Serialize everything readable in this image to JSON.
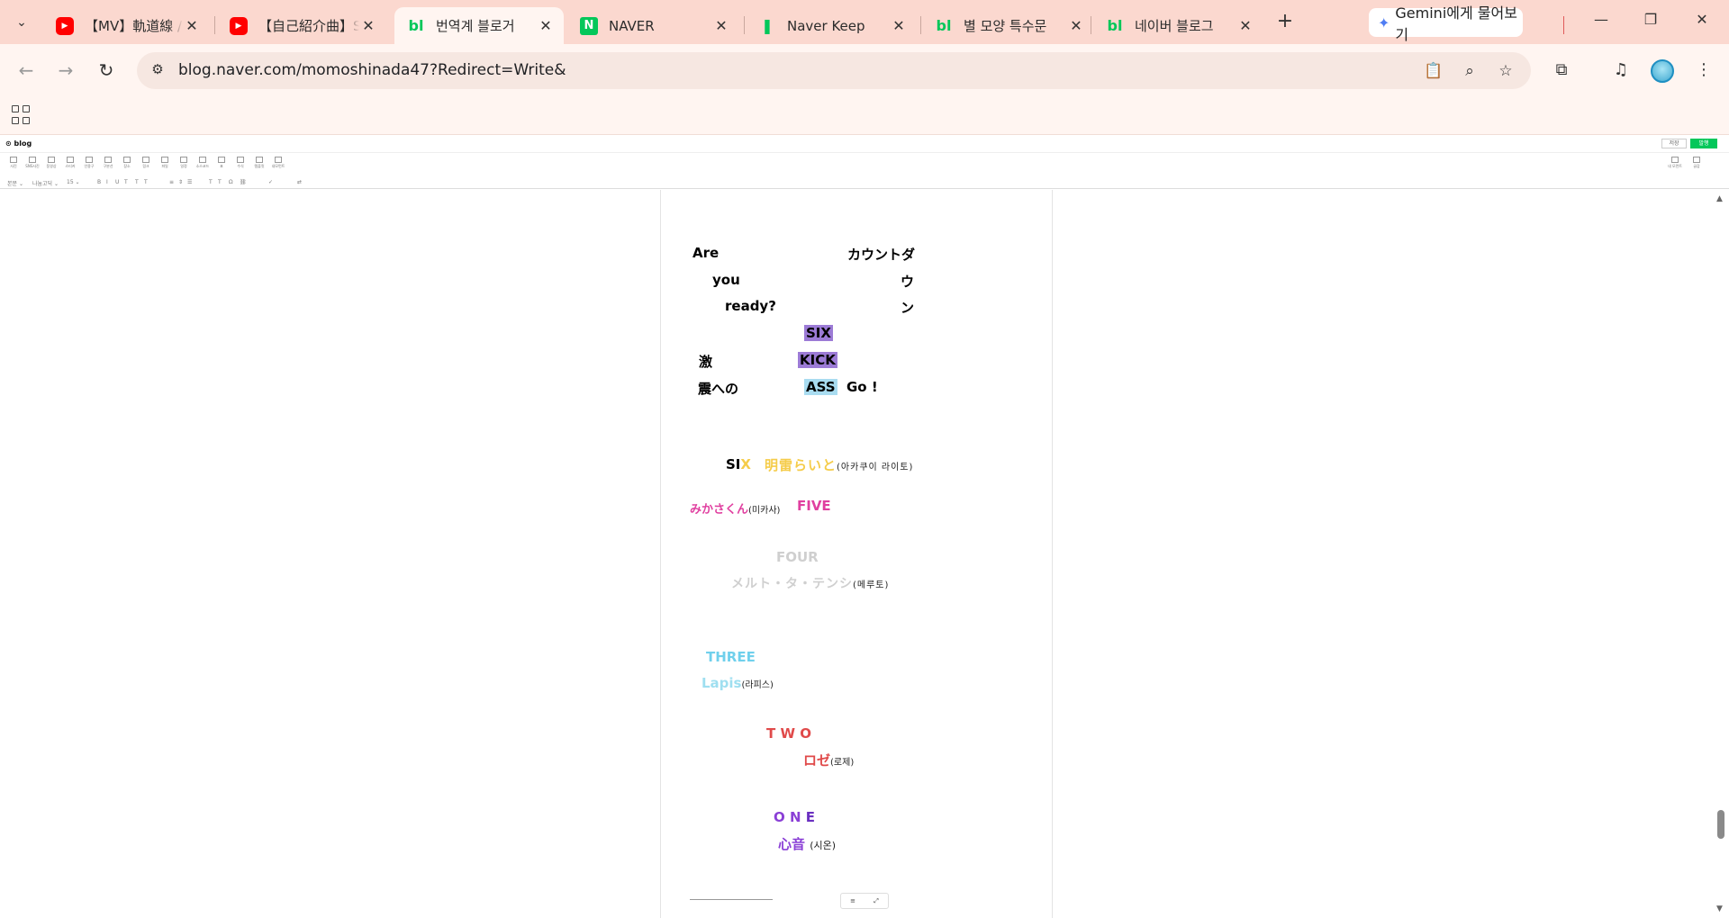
{
  "browser": {
    "tabs": [
      {
        "title": "【MV】軌道線 / E",
        "favicon": "youtube-icon"
      },
      {
        "title": "【自己紹介曲】SI",
        "favicon": "youtube-icon"
      },
      {
        "title": "번역계 블로거 ",
        "favicon": "naver-blog-icon",
        "active": true
      },
      {
        "title": "NAVER",
        "favicon": "naver-icon"
      },
      {
        "title": "Naver Keep",
        "favicon": "naver-keep-icon"
      },
      {
        "title": "별 모양 특수문",
        "favicon": "naver-blog-icon"
      },
      {
        "title": "네이버 블로그",
        "favicon": "naver-blog-icon"
      }
    ],
    "gemini_label": "Gemini에게 물어보기",
    "url": "blog.naver.com/momoshinada47?Redirect=Write&"
  },
  "editor": {
    "logo": "blog",
    "save_label": "저장",
    "publish_label": "발행",
    "tools": [
      "사진",
      "SNS사진",
      "동영상",
      "스티커",
      "인용구",
      "구분선",
      "장소",
      "링크",
      "파일",
      "일정",
      "소스코드",
      "표",
      "수식",
      "템플릿",
      "내모먼트",
      "글감"
    ],
    "right_tools": [
      "내 모먼트",
      "글감"
    ],
    "format": {
      "font_style": "본문",
      "font_family": "나눔고딕",
      "font_size": "15"
    }
  },
  "content": {
    "intro": {
      "are": "Are",
      "you": "you",
      "ready": "ready?",
      "countdown_1": "カウントダ",
      "countdown_2": "ウ",
      "countdown_3": "ン",
      "six": "SIX",
      "kick": "KICK",
      "ass": "ASS",
      "go": "Go !",
      "geki": "激",
      "shin": "震への"
    },
    "six_line": {
      "label_black": "SI",
      "label_yellow": "X",
      "name": "明雷らいと",
      "reading": "(아카쿠이 라이토)"
    },
    "five_line": {
      "name": "みかさくん",
      "reading": "(미카사)",
      "label": "FIVE"
    },
    "four_line": {
      "label": "FOUR",
      "name": "メルト・タ・テンシ",
      "reading": "(메루토)"
    },
    "three_line": {
      "label": "THREE",
      "name": "Lapis",
      "reading": "(라피스)"
    },
    "two_line": {
      "label": "T W O",
      "name": "ロゼ",
      "reading": "(로제)"
    },
    "one_line": {
      "label_a": "O N ",
      "label_b": "E",
      "name": "心音 ",
      "reading": "(시온)"
    }
  },
  "colors": {
    "yellow": "#f5cc4a",
    "pink": "#e040a0",
    "gray": "#cfcfcf",
    "sky": "#70d0ec",
    "red": "#e04a4a",
    "purple": "#8a3fd6",
    "highlight_purple": "#9c7bd6",
    "highlight_blue": "#a9dcf0"
  }
}
